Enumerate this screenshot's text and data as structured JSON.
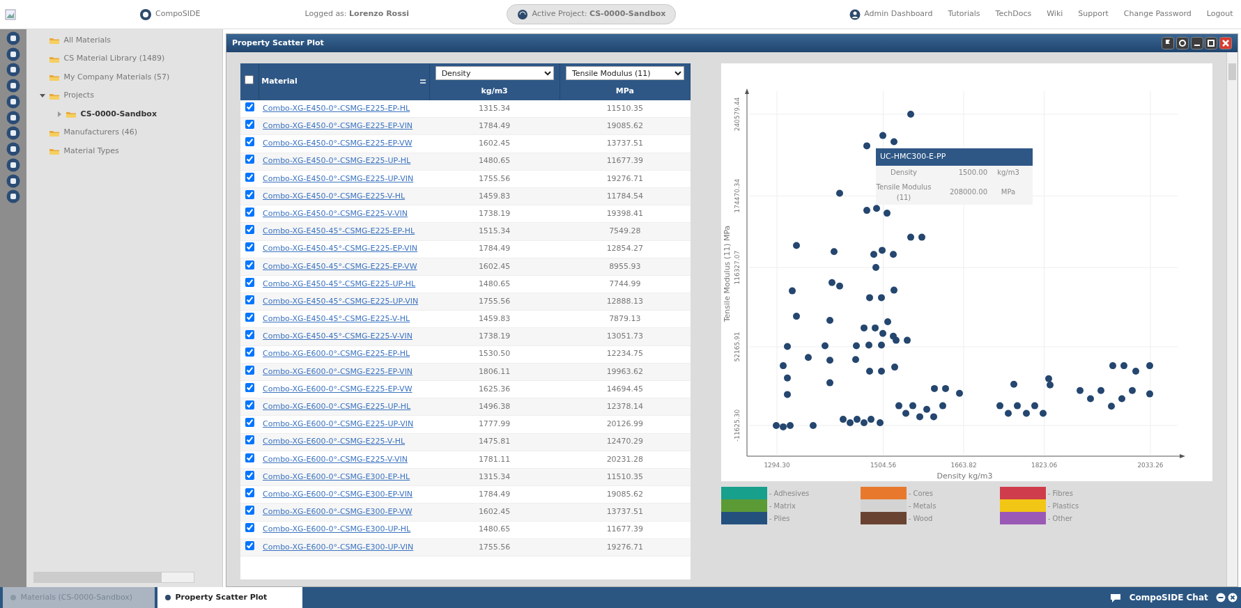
{
  "topbar": {
    "logo_text": "CompoSIDE",
    "logged_as": "Logged as: **Lorenzo Rossi**",
    "active_project": "Active Project: **CS-0000-Sandbox**",
    "links": [
      "Admin Dashboard",
      "Tutorials",
      "TechDocs",
      "Wiki",
      "Support",
      "Change Password",
      "Logout"
    ]
  },
  "tree": [
    {
      "label": "All Materials",
      "selected": false
    },
    {
      "label": "CS Material Library (1489)",
      "selected": false
    },
    {
      "label": "My Company Materials (57)",
      "selected": false
    },
    {
      "label": "Projects",
      "selected": false,
      "expanded": true,
      "children": [
        {
          "label": "CS-0000-Sandbox",
          "selected": true,
          "expanded": false
        }
      ]
    },
    {
      "label": "Manufacturers (46)",
      "selected": false
    },
    {
      "label": "Material Types",
      "selected": false
    }
  ],
  "window": {
    "title": "Property Scatter Plot"
  },
  "table": {
    "select_all_checked": false,
    "material_header": "Material",
    "columns": [
      {
        "select": "Density",
        "unit": "kg/m3"
      },
      {
        "select": "Tensile Modulus (11)",
        "unit": "MPa"
      }
    ],
    "rows": [
      {
        "material": "Combo-XG-E450-0°-CSMG-E225-EP-HL",
        "density": "1315.34",
        "modulus": "11510.35",
        "checked": true
      },
      {
        "material": "Combo-XG-E450-0°-CSMG-E225-EP-VIN",
        "density": "1784.49",
        "modulus": "19085.62",
        "checked": true
      },
      {
        "material": "Combo-XG-E450-0°-CSMG-E225-EP-VW",
        "density": "1602.45",
        "modulus": "13737.51",
        "checked": true
      },
      {
        "material": "Combo-XG-E450-0°-CSMG-E225-UP-HL",
        "density": "1480.65",
        "modulus": "11677.39",
        "checked": true
      },
      {
        "material": "Combo-XG-E450-0°-CSMG-E225-UP-VIN",
        "density": "1755.56",
        "modulus": "19276.71",
        "checked": true
      },
      {
        "material": "Combo-XG-E450-0°-CSMG-E225-V-HL",
        "density": "1459.83",
        "modulus": "11784.54",
        "checked": true
      },
      {
        "material": "Combo-XG-E450-0°-CSMG-E225-V-VIN",
        "density": "1738.19",
        "modulus": "19398.41",
        "checked": true
      },
      {
        "material": "Combo-XG-E450-45°-CSMG-E225-EP-HL",
        "density": "1515.34",
        "modulus": "7549.28",
        "checked": true
      },
      {
        "material": "Combo-XG-E450-45°-CSMG-E225-EP-VIN",
        "density": "1784.49",
        "modulus": "12854.27",
        "checked": true
      },
      {
        "material": "Combo-XG-E450-45°-CSMG-E225-EP-VW",
        "density": "1602.45",
        "modulus": "8955.93",
        "checked": true
      },
      {
        "material": "Combo-XG-E450-45°-CSMG-E225-UP-HL",
        "density": "1480.65",
        "modulus": "7744.99",
        "checked": true
      },
      {
        "material": "Combo-XG-E450-45°-CSMG-E225-UP-VIN",
        "density": "1755.56",
        "modulus": "12888.13",
        "checked": true
      },
      {
        "material": "Combo-XG-E450-45°-CSMG-E225-V-HL",
        "density": "1459.83",
        "modulus": "7879.13",
        "checked": true
      },
      {
        "material": "Combo-XG-E450-45°-CSMG-E225-V-VIN",
        "density": "1738.19",
        "modulus": "13051.73",
        "checked": true
      },
      {
        "material": "Combo-XG-E600-0°-CSMG-E225-EP-HL",
        "density": "1530.50",
        "modulus": "12234.75",
        "checked": true
      },
      {
        "material": "Combo-XG-E600-0°-CSMG-E225-EP-VIN",
        "density": "1806.11",
        "modulus": "19963.62",
        "checked": true
      },
      {
        "material": "Combo-XG-E600-0°-CSMG-E225-EP-VW",
        "density": "1625.36",
        "modulus": "14694.45",
        "checked": true
      },
      {
        "material": "Combo-XG-E600-0°-CSMG-E225-UP-HL",
        "density": "1496.38",
        "modulus": "12378.14",
        "checked": true
      },
      {
        "material": "Combo-XG-E600-0°-CSMG-E225-UP-VIN",
        "density": "1777.99",
        "modulus": "20126.99",
        "checked": true
      },
      {
        "material": "Combo-XG-E600-0°-CSMG-E225-V-HL",
        "density": "1475.81",
        "modulus": "12470.29",
        "checked": true
      },
      {
        "material": "Combo-XG-E600-0°-CSMG-E225-V-VIN",
        "density": "1781.11",
        "modulus": "20231.28",
        "checked": true
      },
      {
        "material": "Combo-XG-E600-0°-CSMG-E300-EP-HL",
        "density": "1315.34",
        "modulus": "11510.35",
        "checked": true
      },
      {
        "material": "Combo-XG-E600-0°-CSMG-E300-EP-VIN",
        "density": "1784.49",
        "modulus": "19085.62",
        "checked": true
      },
      {
        "material": "Combo-XG-E600-0°-CSMG-E300-EP-VW",
        "density": "1602.45",
        "modulus": "13737.51",
        "checked": true
      },
      {
        "material": "Combo-XG-E600-0°-CSMG-E300-UP-HL",
        "density": "1480.65",
        "modulus": "11677.39",
        "checked": true
      },
      {
        "material": "Combo-XG-E600-0°-CSMG-E300-UP-VIN",
        "density": "1755.56",
        "modulus": "19276.71",
        "checked": true
      }
    ]
  },
  "chart": {
    "chart_data": {
      "type": "scatter",
      "xlabel": "Density kg/m3",
      "ylabel": "Tensile Modulus (11) MPa",
      "grid": true,
      "xlim": [
        1235.0,
        2096.7
      ],
      "ylim": [
        -36455,
        259202
      ],
      "xticks": [
        {
          "value": 1294.3,
          "label": "1294.30"
        },
        {
          "value": 1504.56,
          "label": "1504.56"
        },
        {
          "value": 1663.82,
          "label": "1663.82"
        },
        {
          "value": 1823.06,
          "label": "1823.06"
        },
        {
          "value": 2033.26,
          "label": "2033.26"
        }
      ],
      "yticks": [
        {
          "value": -11625.3,
          "label": "-11625.30"
        },
        {
          "value": 52165.91,
          "label": "52165.91"
        },
        {
          "value": 116327.07,
          "label": "116327.07"
        },
        {
          "value": 174470.34,
          "label": "174470.34"
        },
        {
          "value": 240579.44,
          "label": "240579.44"
        }
      ],
      "x": [
        1559.0,
        1503.9,
        1525.9,
        1472.2,
        1418.4,
        1472.2,
        1491.5,
        1512.1,
        1559.0,
        1581.1,
        1332.9,
        1407.4,
        1485.9,
        1502.5,
        1524.5,
        1490.1,
        1403.2,
        1418.4,
        1324.6,
        1525.9,
        1477.7,
        1501.1,
        1332.9,
        1399.1,
        1466.6,
        1488.7,
        1513.5,
        1503.9,
        1524.5,
        1530.1,
        1552.1,
        1315.0,
        1389.4,
        1451.5,
        1476.3,
        1501.1,
        1356.3,
        1399.1,
        1306.7,
        1450.1,
        1477.7,
        1501.1,
        1527.3,
        1315.0,
        1399.1,
        1315.0,
        1292.9,
        1306.7,
        1320.5,
        1366.0,
        1425.3,
        1439.1,
        1452.9,
        1466.6,
        1480.4,
        1498.4,
        1535.6,
        1549.4,
        1563.1,
        1576.9,
        1590.7,
        1604.5,
        1622.4,
        1605.9,
        1627.9,
        1655.5,
        1735.5,
        1752.0,
        1770.0,
        1787.9,
        1804.4,
        1821.0,
        1763.1,
        1832.0,
        1834.7,
        1894.0,
        1914.7,
        1935.4,
        1956.1,
        1976.8,
        1997.4,
        1958.8,
        1980.9,
        2004.3,
        2031.9,
        2031.9
      ],
      "series": [
        {
          "color": "#24466f",
          "values": [
            240579,
            223321,
            218311,
            214971,
            176558,
            162641,
            164311,
            160414,
            140930,
            140930,
            134250,
            129239,
            127013,
            130353,
            127013,
            116436,
            104189,
            101405,
            97509,
            98065,
            91942,
            91942,
            76909,
            73569,
            67445,
            67445,
            72455,
            62991,
            60764,
            57424,
            57424,
            52414,
            52971,
            52971,
            53528,
            53528,
            43507,
            41280,
            36826,
            41837,
            32373,
            32373,
            35713,
            26929,
            23002,
            13538,
            -11611,
            -12724,
            -11611,
            -11611,
            -6600,
            -9384,
            -6600,
            -9384,
            -6600,
            -9384,
            4377,
            -1747,
            4377,
            -4531,
            1500,
            -4531,
            4377,
            18347,
            18347,
            14451,
            4377,
            -1747,
            4377,
            -1747,
            4377,
            -1747,
            21788,
            26355,
            21232,
            16778,
            10098,
            16778,
            4044,
            10098,
            16778,
            36826,
            36826,
            32373,
            36826,
            13994
          ]
        }
      ]
    },
    "tooltip": {
      "title": "UC-HMC300-E-PP",
      "rows": [
        {
          "label": "Density",
          "value": "1500.00",
          "unit": "kg/m3"
        },
        {
          "label": "Tensile Modulus (11)",
          "value": "208000.00",
          "unit": "MPa"
        }
      ]
    },
    "legend": [
      {
        "label": "- Adhesives",
        "color": "#17a08c"
      },
      {
        "label": "- Cores",
        "color": "#e8792c"
      },
      {
        "label": "- Fibres",
        "color": "#cf3d4c"
      },
      {
        "label": "- Matrix",
        "color": "#5c9a36"
      },
      {
        "label": "- Metals",
        "color": "#d3d3d3"
      },
      {
        "label": "- Plastics",
        "color": "#f2c614"
      },
      {
        "label": "- Plies",
        "color": "#24507e"
      },
      {
        "label": "- Wood",
        "color": "#6a4231"
      },
      {
        "label": "- Other",
        "color": "#9b59b6"
      }
    ]
  },
  "taskbar": {
    "tabs": [
      {
        "label": "Materials (CS-0000-Sandbox)",
        "selected": false
      },
      {
        "label": "Property Scatter Plot",
        "selected": true
      }
    ],
    "chat": "CompoSIDE Chat"
  }
}
